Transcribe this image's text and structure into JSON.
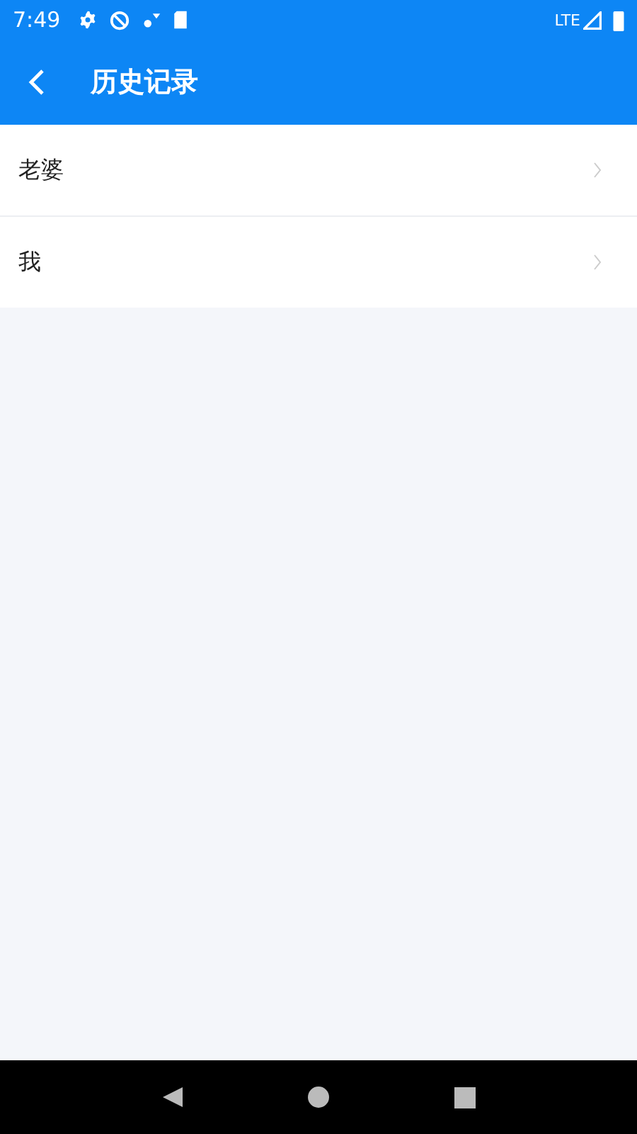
{
  "status_bar": {
    "time": "7:49",
    "network": "LTE"
  },
  "header": {
    "title": "历史记录"
  },
  "history": [
    {
      "label": "老婆"
    },
    {
      "label": "我"
    }
  ]
}
